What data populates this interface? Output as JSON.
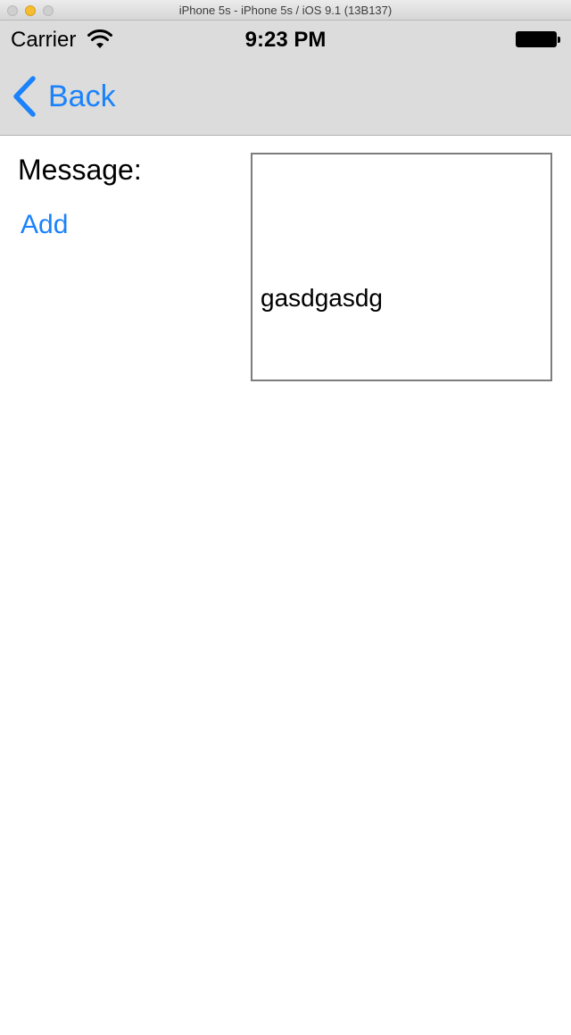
{
  "window": {
    "title": "iPhone 5s - iPhone 5s / iOS 9.1 (13B137)"
  },
  "status_bar": {
    "carrier": "Carrier",
    "time": "9:23 PM",
    "wifi_icon": "wifi-icon",
    "battery_icon": "battery-icon"
  },
  "nav": {
    "back_label": "Back",
    "back_icon": "chevron-left-icon"
  },
  "content": {
    "message_label": "Message:",
    "add_label": "Add",
    "message_text": "gasdgasdg"
  },
  "colors": {
    "tint": "#1a82fb",
    "nav_background": "#dcdcdc"
  }
}
